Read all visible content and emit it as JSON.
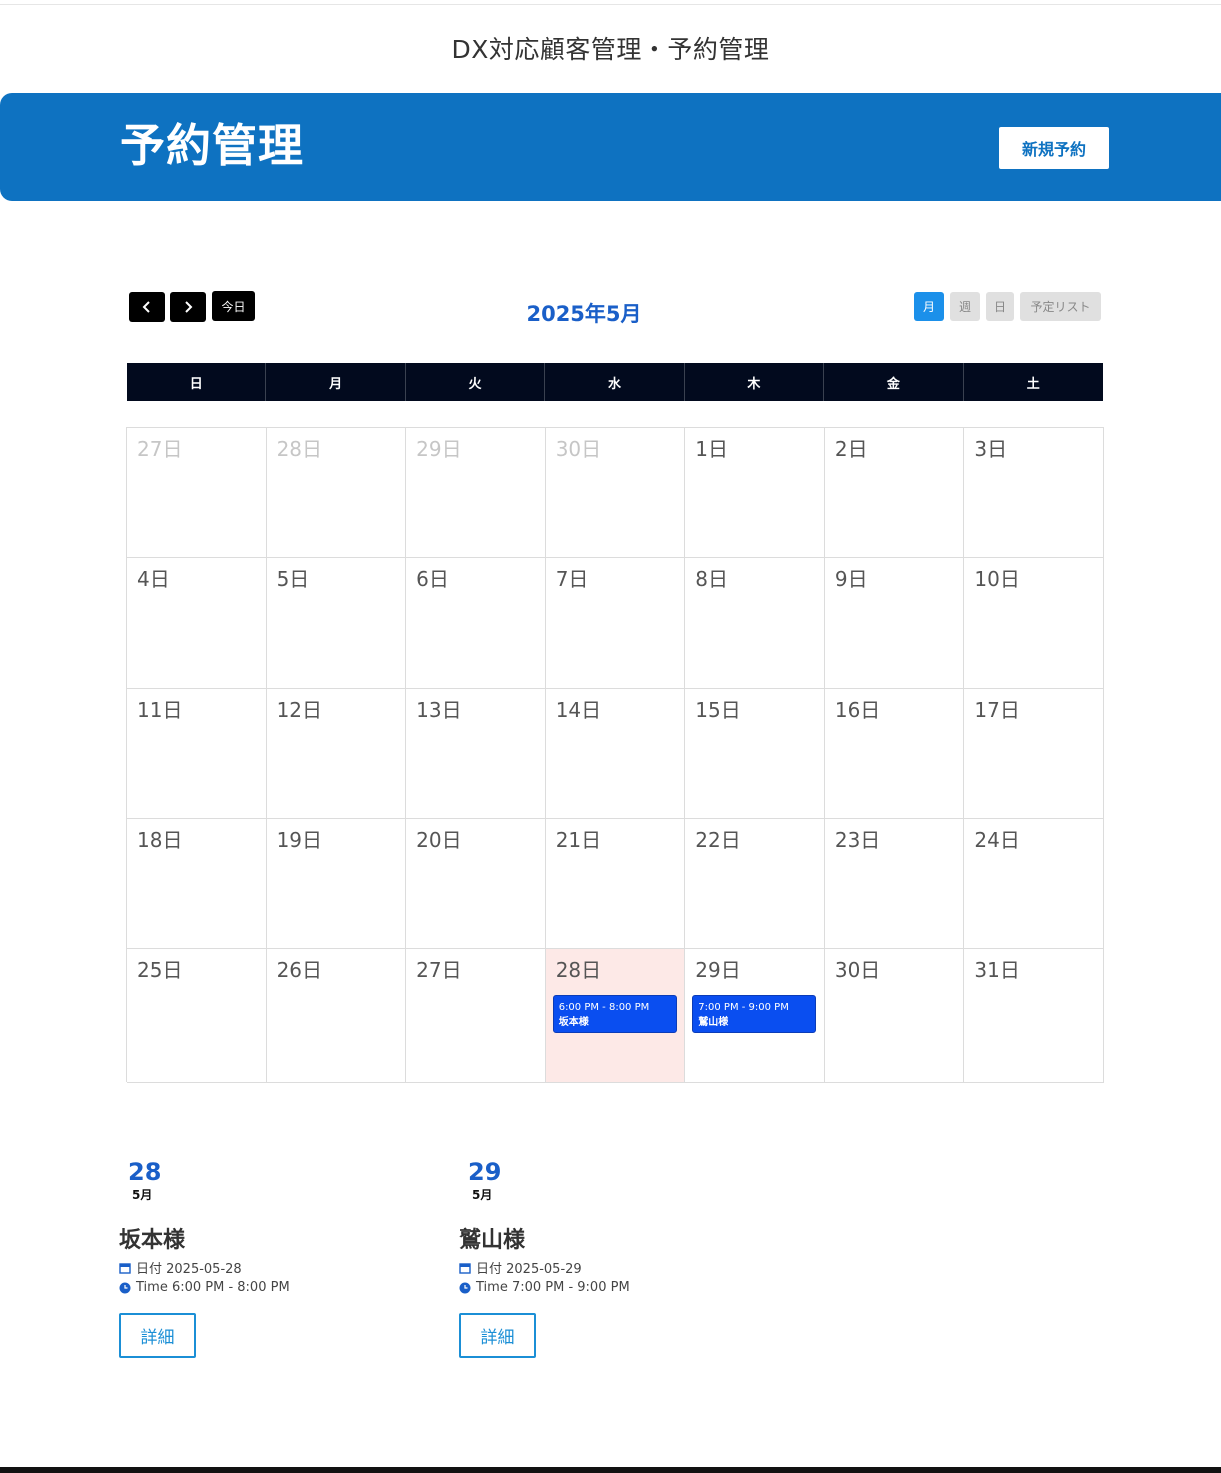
{
  "site": {
    "title": "DX対応顧客管理・予約管理"
  },
  "banner": {
    "title": "予約管理",
    "new_button": "新規予約",
    "accent": "#0e72c1"
  },
  "toolbar": {
    "prev_icon": "chevron-left-icon",
    "next_icon": "chevron-right-icon",
    "today": "今日",
    "title": "2025年5月",
    "views": {
      "month": "月",
      "week": "週",
      "day": "日",
      "list": "予定リスト"
    },
    "active_view": "month"
  },
  "calendar": {
    "weekdays": [
      "日",
      "月",
      "火",
      "水",
      "木",
      "金",
      "土"
    ],
    "days": [
      [
        "27日",
        "28日",
        "29日",
        "30日",
        "1日",
        "2日",
        "3日"
      ],
      [
        "4日",
        "5日",
        "6日",
        "7日",
        "8日",
        "9日",
        "10日"
      ],
      [
        "11日",
        "12日",
        "13日",
        "14日",
        "15日",
        "16日",
        "17日"
      ],
      [
        "18日",
        "19日",
        "20日",
        "21日",
        "22日",
        "23日",
        "24日"
      ],
      [
        "25日",
        "26日",
        "27日",
        "28日",
        "29日",
        "30日",
        "31日"
      ]
    ],
    "events": {
      "may28": {
        "time": "6:00 PM - 8:00 PM",
        "name": "坂本様"
      },
      "may29": {
        "time": "7:00 PM - 9:00 PM",
        "name": "鷲山様"
      }
    },
    "event_color": "#0a4ef0",
    "today_color": "#fde9e7"
  },
  "cards": [
    {
      "day": "28",
      "month": "5月",
      "name": "坂本様",
      "date": "日付 2025-05-28",
      "time": "Time 6:00 PM - 8:00 PM",
      "button": "詳細"
    },
    {
      "day": "29",
      "month": "5月",
      "name": "鷲山様",
      "date": "日付 2025-05-29",
      "time": "Time 7:00 PM - 9:00 PM",
      "button": "詳細"
    }
  ]
}
